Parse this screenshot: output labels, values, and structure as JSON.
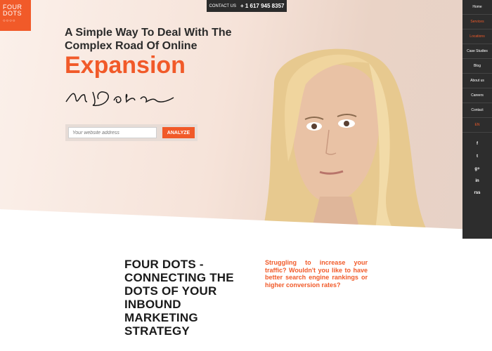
{
  "logo": {
    "line1": "FOUR",
    "line2": "DOTS",
    "dots": "○○○○"
  },
  "contact": {
    "label": "CONTACT US",
    "phone": "+ 1 617 945 8357"
  },
  "hero": {
    "headline": "A Simple Way To Deal With The Complex Road Of Online",
    "highlight": "Expansion",
    "search_placeholder": "Your website address",
    "analyze_label": "ANALYZE"
  },
  "nav": {
    "items": [
      {
        "label": "Home"
      },
      {
        "label": "Services"
      },
      {
        "label": "Locations"
      },
      {
        "label": "Case Studies"
      },
      {
        "label": "Blog"
      },
      {
        "label": "About us"
      },
      {
        "label": "Careers"
      },
      {
        "label": "Contact"
      },
      {
        "label": "EN"
      }
    ],
    "social": [
      "f",
      "t",
      "g+",
      "in",
      "rss"
    ]
  },
  "section": {
    "title": "FOUR DOTS - CONNECTING THE DOTS OF YOUR INBOUND MARKETING STRATEGY",
    "subtitle": "Struggling to increase your traffic? Wouldn't you like to have better search engine rankings or higher conversion rates?"
  },
  "colors": {
    "accent": "#f15a29",
    "dark": "#2d2d2d"
  }
}
